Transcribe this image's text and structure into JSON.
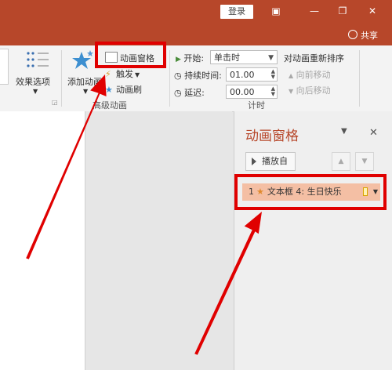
{
  "titlebar": {
    "login_label": "登录",
    "share_label": "共享"
  },
  "ribbon": {
    "effect_options_label": "效果选项",
    "add_animation_label": "添加动画",
    "animation_pane_label": "动画窗格",
    "trigger_label": "触发",
    "animation_painter_label": "动画刷",
    "advanced_group_label": "高级动画",
    "start_label": "开始:",
    "start_value": "单击时",
    "duration_label": "持续时间:",
    "duration_value": "01.00",
    "delay_label": "延迟:",
    "delay_value": "00.00",
    "timing_group_label": "计时",
    "reorder_label": "对动画重新排序",
    "move_earlier_label": "向前移动",
    "move_later_label": "向后移动"
  },
  "pane": {
    "title": "动画窗格",
    "play_label": "播放自",
    "items": [
      {
        "index": "1",
        "text": "文本框 4: 生日快乐"
      }
    ]
  },
  "colors": {
    "brand": "#b7472a",
    "highlight": "#e00000",
    "item_bg": "#f4bfa4"
  }
}
